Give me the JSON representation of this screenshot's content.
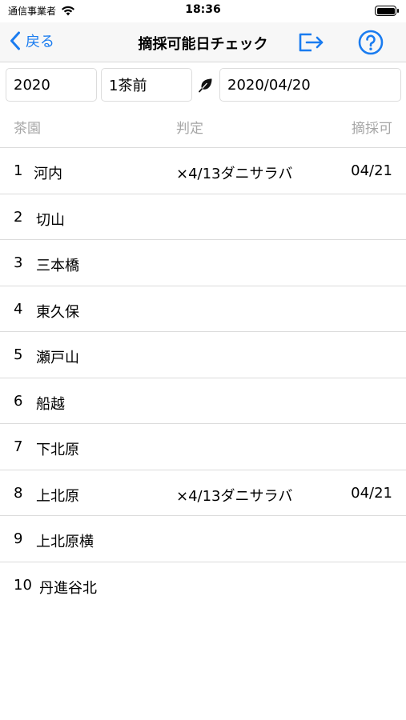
{
  "status_bar": {
    "carrier": "通信事業者",
    "time": "18:36"
  },
  "nav": {
    "back_label": "戻る",
    "title": "摘採可能日チェック",
    "accent_color": "#1a7cf0"
  },
  "filters": {
    "year": "2020",
    "tea_period": "1茶前",
    "date": "2020/04/20"
  },
  "columns": {
    "garden": "茶園",
    "judgement": "判定",
    "pickable": "摘採可"
  },
  "rows": [
    {
      "num": "1",
      "name": "河内",
      "judgement": "×4/13ダニサラバ",
      "pickable": "04/21"
    },
    {
      "num": "2",
      "name": "切山",
      "judgement": "",
      "pickable": ""
    },
    {
      "num": "3",
      "name": "三本橋",
      "judgement": "",
      "pickable": ""
    },
    {
      "num": "4",
      "name": "東久保",
      "judgement": "",
      "pickable": ""
    },
    {
      "num": "5",
      "name": "瀬戸山",
      "judgement": "",
      "pickable": ""
    },
    {
      "num": "6",
      "name": "船越",
      "judgement": "",
      "pickable": ""
    },
    {
      "num": "7",
      "name": "下北原",
      "judgement": "",
      "pickable": ""
    },
    {
      "num": "8",
      "name": "上北原",
      "judgement": "×4/13ダニサラバ",
      "pickable": "04/21"
    },
    {
      "num": "9",
      "name": "上北原横",
      "judgement": "",
      "pickable": ""
    },
    {
      "num": "10",
      "name": "丹進谷北",
      "judgement": "",
      "pickable": ""
    }
  ]
}
